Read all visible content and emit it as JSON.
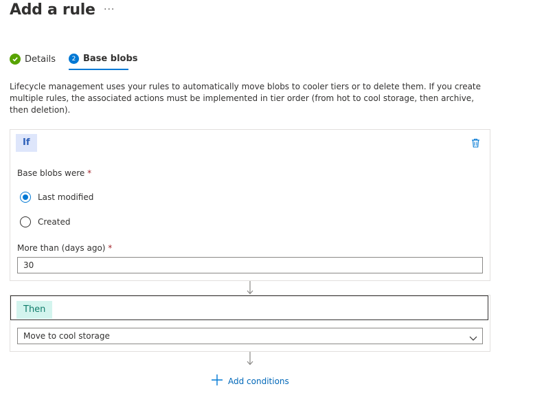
{
  "page": {
    "title": "Add a rule",
    "more_label": "···"
  },
  "tabs": [
    {
      "label": "Details",
      "state": "completed",
      "icon": "check-circle-icon"
    },
    {
      "label": "Base blobs",
      "state": "active",
      "step_number": "2"
    }
  ],
  "description": "Lifecycle management uses your rules to automatically move blobs to cooler tiers or to delete them. If you create multiple rules, the associated actions must be implemented in tier order (from hot to cool storage, then archive, then deletion).",
  "if_block": {
    "label": "If",
    "delete_icon": "trash-icon",
    "base_blobs_label": "Base blobs were",
    "required_mark": "*",
    "options": [
      {
        "label": "Last modified",
        "selected": true
      },
      {
        "label": "Created",
        "selected": false
      }
    ],
    "days_label": "More than (days ago)",
    "days_value": "30"
  },
  "then_block": {
    "label": "Then",
    "action_value": "Move to cool storage"
  },
  "add_conditions": {
    "label": "Add conditions",
    "icon": "plus-icon"
  },
  "colors": {
    "accent": "#0078d4",
    "success": "#57a300",
    "if_pill_bg": "#dee6fb",
    "then_pill_bg": "#d3f4ee"
  }
}
